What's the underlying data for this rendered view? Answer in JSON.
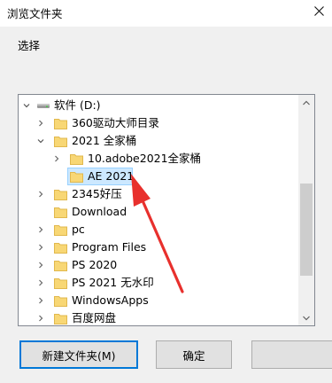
{
  "window": {
    "title": "浏览文件夹"
  },
  "instruction": "选择",
  "tree": {
    "items": [
      {
        "label": "软件 (D:)",
        "type": "drive",
        "expanded": true
      },
      {
        "label": "360驱动大师目录",
        "type": "folder",
        "expanded": false
      },
      {
        "label": "2021 全家桶",
        "type": "folder",
        "expanded": true
      },
      {
        "label": "10.adobe2021全家桶",
        "type": "folder",
        "expanded": false
      },
      {
        "label": "AE 2021",
        "type": "folder",
        "selected": true
      },
      {
        "label": "2345好压",
        "type": "folder",
        "expanded": false
      },
      {
        "label": "Download",
        "type": "folder"
      },
      {
        "label": "pc",
        "type": "folder",
        "expanded": false
      },
      {
        "label": "Program Files",
        "type": "folder",
        "expanded": false
      },
      {
        "label": "PS 2020",
        "type": "folder",
        "expanded": false
      },
      {
        "label": "PS 2021 无水印",
        "type": "folder",
        "expanded": false
      },
      {
        "label": "WindowsApps",
        "type": "folder",
        "expanded": false
      },
      {
        "label": "百度网盘",
        "type": "folder",
        "expanded": false
      }
    ]
  },
  "buttons": {
    "new_folder": "新建文件夹(M)",
    "ok": "确定"
  },
  "colors": {
    "selection_bg": "#cce8ff",
    "selection_border": "#99d1ff",
    "folder": "#f8d775",
    "annotation_arrow": "#e8302d",
    "focus_border": "#0078d7"
  },
  "icons": {
    "close": "close-icon",
    "drive": "drive-icon",
    "folder": "folder-icon",
    "expand": "chevron-right-icon",
    "collapse": "chevron-down-icon"
  }
}
